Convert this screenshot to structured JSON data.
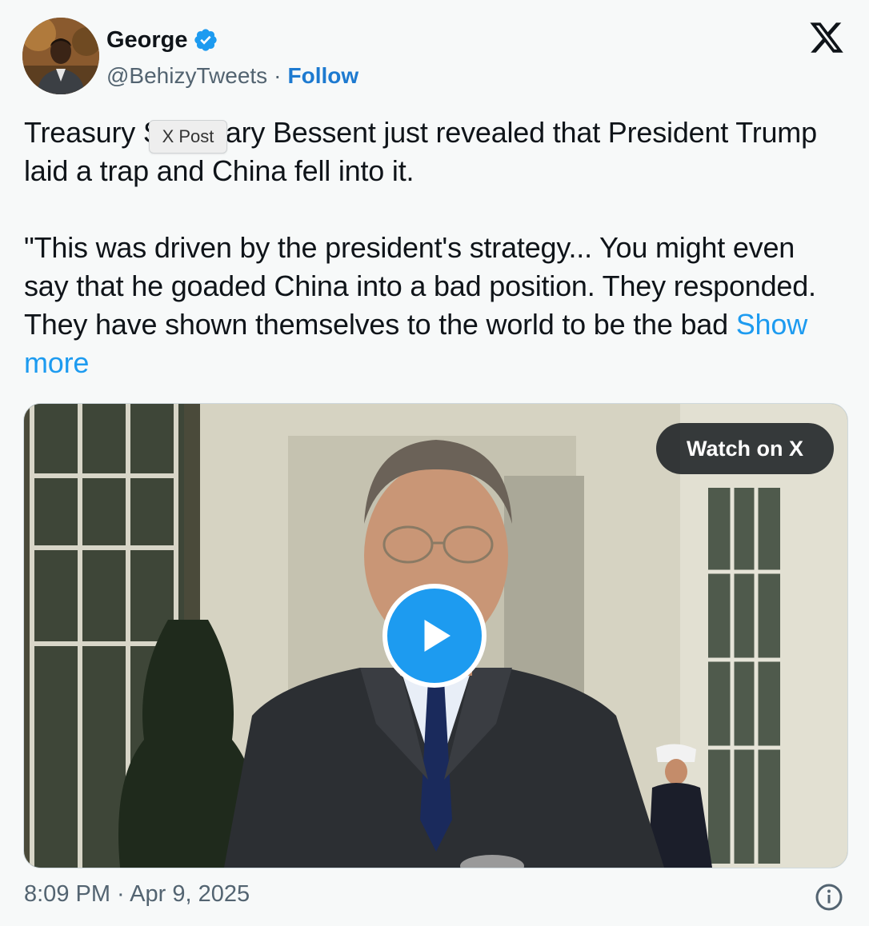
{
  "author": {
    "name": "George",
    "handle": "@BehizyTweets",
    "separator": "·",
    "follow_label": "Follow",
    "verified_icon": "verified-badge-icon",
    "verified_color": "#1d9bf0"
  },
  "platform_icon": "x-logo-icon",
  "tooltip_text": "X Post",
  "tweet": {
    "text": "Treasury Secretary Bessent just revealed that President Trump laid a trap and China fell into it.\n\n\"This was driven by the president's strategy... You might even say that he goaded China into a bad position. They responded. They have shown themselves to the world to be the bad ",
    "show_more_label": "Show more"
  },
  "media": {
    "watch_label": "Watch on X",
    "play_icon": "play-icon"
  },
  "timestamp": "8:09 PM · Apr 9, 2025",
  "info_icon": "info-icon",
  "colors": {
    "accent": "#1d9bf0",
    "follow": "#1d7ad0",
    "muted_text": "#536471",
    "background": "#f7f9f9"
  }
}
